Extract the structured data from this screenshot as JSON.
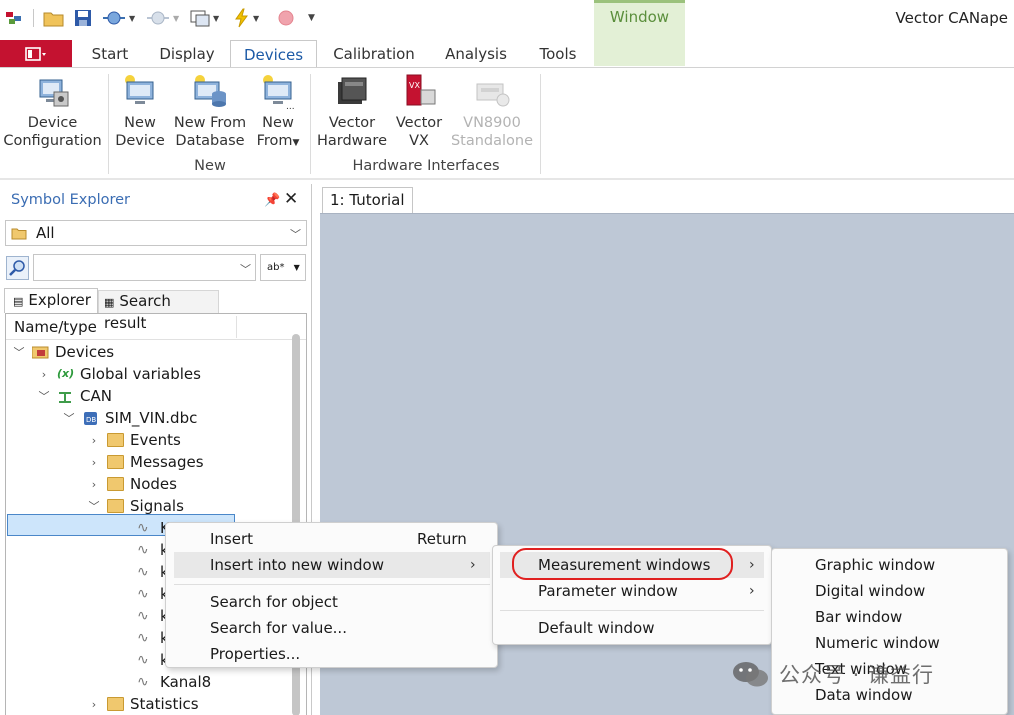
{
  "app": {
    "title": "Vector CANape",
    "context_tab_group": "Window"
  },
  "ribbon_tabs": [
    "Start",
    "Display",
    "Devices",
    "Calibration",
    "Analysis",
    "Tools"
  ],
  "active_tab": "Devices",
  "ribbon": {
    "device_configuration": {
      "line1": "Device",
      "line2": "Configuration"
    },
    "new_device": {
      "line1": "New",
      "line2": "Device"
    },
    "new_from_database": {
      "line1": "New From",
      "line2": "Database"
    },
    "new_from": {
      "line1": "New",
      "line2": "From"
    },
    "vector_hardware": {
      "line1": "Vector",
      "line2": "Hardware"
    },
    "vector_vx": {
      "line1": "Vector",
      "line2": "VX"
    },
    "vn8900": {
      "line1": "VN8900",
      "line2": "Standalone"
    },
    "group_new": "New",
    "group_hardware": "Hardware Interfaces"
  },
  "explorer": {
    "title": "Symbol Explorer",
    "filter_value": "All",
    "search_value": "",
    "match_mode": "ab*",
    "tab_explorer": "Explorer",
    "tab_search": "Search result",
    "column_header": "Name/type",
    "tree": {
      "devices": "Devices",
      "global_variables": "Global variables",
      "can": "CAN",
      "dbc": "SIM_VIN.dbc",
      "events": "Events",
      "messages": "Messages",
      "nodes": "Nodes",
      "signals": "Signals",
      "signal_items": [
        "Ka",
        "k",
        "k",
        "k",
        "k",
        "k",
        "k"
      ],
      "kanal8": "Kanal8",
      "statistics": "Statistics"
    }
  },
  "document": {
    "tab": "1: Tutorial"
  },
  "context_menu": {
    "insert": "Insert",
    "insert_shortcut": "Return",
    "insert_new_window": "Insert into new window",
    "search_object": "Search for object",
    "search_value": "Search for value...",
    "properties": "Properties..."
  },
  "submenu_window": {
    "measurement": "Measurement windows",
    "parameter": "Parameter window",
    "default": "Default window"
  },
  "submenu_measurement": [
    "Graphic window",
    "Digital window",
    "Bar window",
    "Numeric window",
    "Text window",
    "Data window"
  ],
  "watermark": "公众号 · 谦益行",
  "colors": {
    "accent": "#1c5aa6",
    "file_tab": "#c41230",
    "doc_background": "#bec8d6",
    "highlight": "#e02020"
  }
}
